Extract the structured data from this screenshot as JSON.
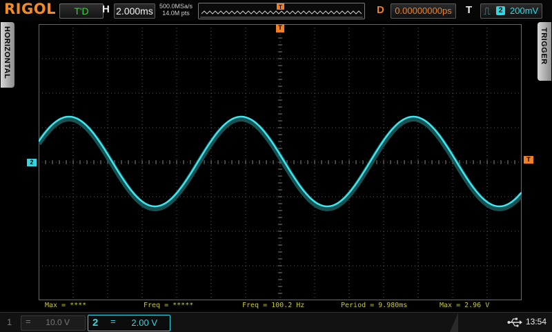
{
  "brand": "RIGOL",
  "status": {
    "run_state": "T'D"
  },
  "horizontal": {
    "letter": "H",
    "timebase": "2.000ms",
    "sample_rate": "500.0MSa/s",
    "memory_points": "14.0M pts",
    "side_tab": "HORIZONTAL"
  },
  "delay": {
    "letter": "D",
    "value": "0.00000000ps"
  },
  "trigger": {
    "letter": "T",
    "edge_icon": "rising-edge-icon",
    "channel": "2",
    "level": "200mV",
    "side_tab": "TRIGGER",
    "level_marker": "T",
    "position_marker": "T"
  },
  "channels": {
    "ch1": {
      "number": "1",
      "coupling": "=",
      "scale": "10.0 V",
      "active": false
    },
    "ch2": {
      "number": "2",
      "coupling": "=",
      "scale": "2.00 V",
      "active": true,
      "marker": "2",
      "color": "#32d6e0"
    }
  },
  "measurements": [
    {
      "text": "Max = ****"
    },
    {
      "text": "Freq = *****"
    },
    {
      "text": "Freq = 100.2 Hz"
    },
    {
      "text": "Period = 9.980ms"
    },
    {
      "text": "Max = 2.96 V"
    }
  ],
  "system": {
    "time": "13:54",
    "usb_icon": "usb-icon"
  },
  "colors": {
    "brand": "#f58a1f",
    "trigger": "#f08020",
    "ch2": "#32d6e0",
    "measurement": "#c8c830",
    "run_state": "#37d03d"
  }
}
